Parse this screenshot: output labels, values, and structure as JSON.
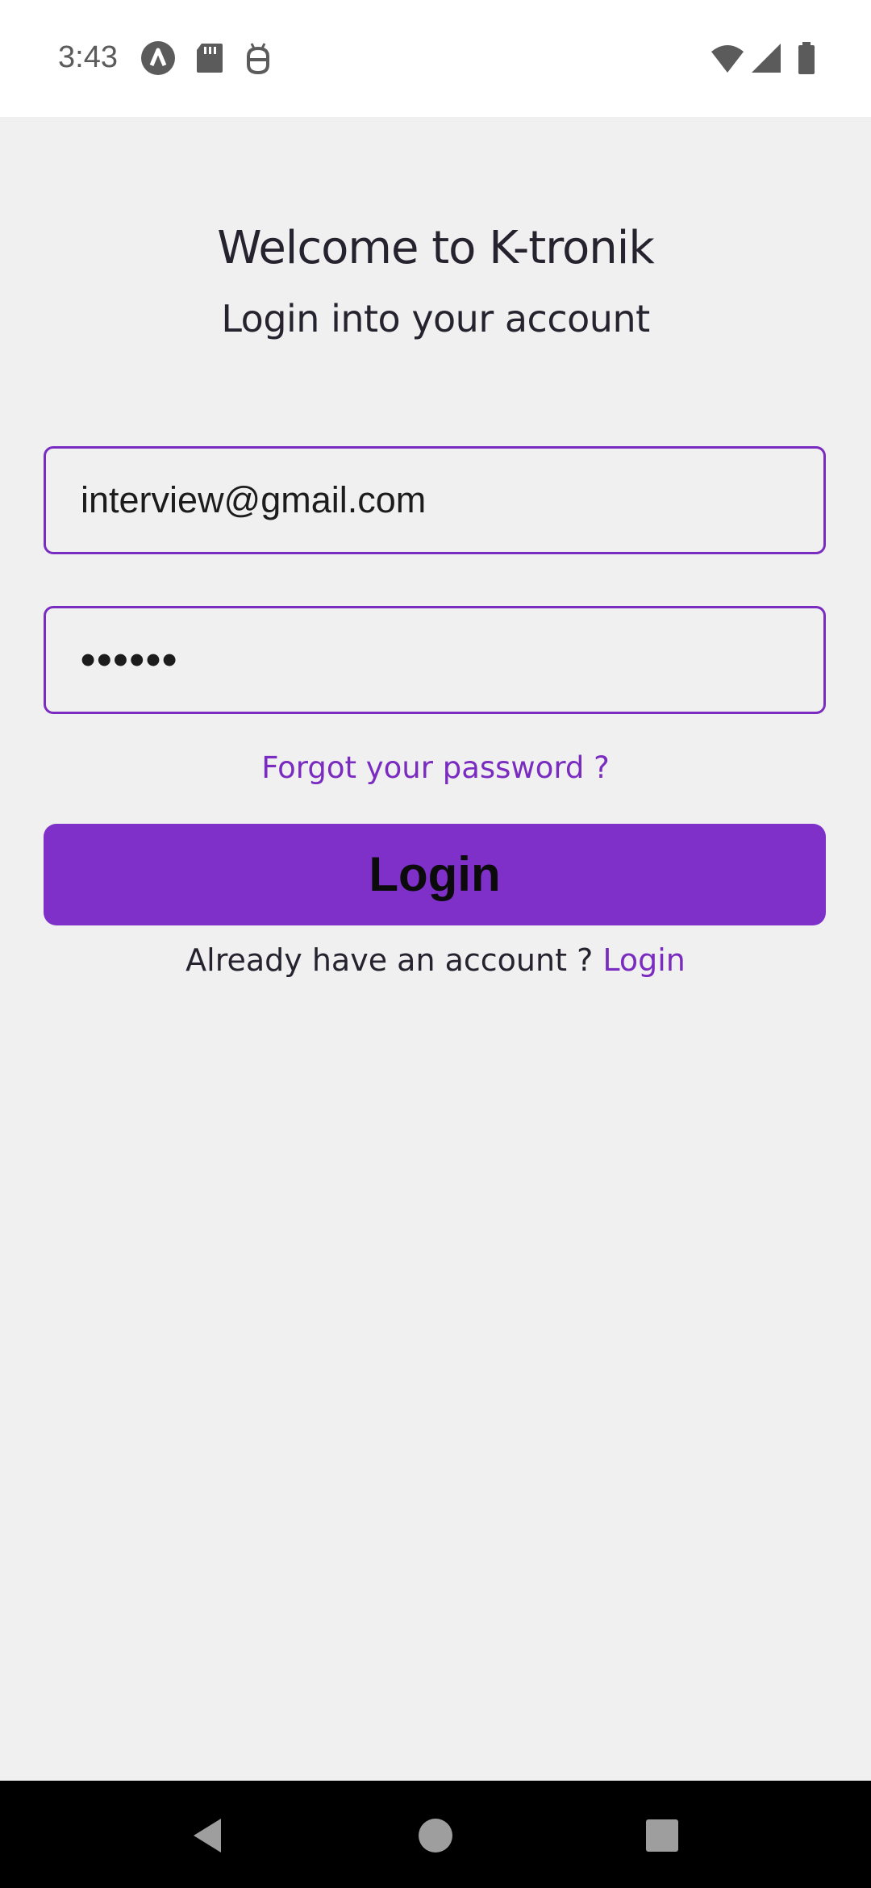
{
  "status_bar": {
    "time": "3:43",
    "icons": [
      "app-a-icon",
      "sd-card-icon",
      "android-debug-icon",
      "wifi-icon",
      "signal-icon",
      "battery-icon"
    ]
  },
  "header": {
    "title": "Welcome to K-tronik",
    "subtitle": "Login into your account"
  },
  "form": {
    "email_value": "interview@gmail.com",
    "password_value": "••••••",
    "forgot_label": "Forgot your password ?",
    "login_label": "Login"
  },
  "footer": {
    "prompt": "Already have an account ?",
    "link": "Login"
  },
  "nav_bar": {
    "icons": [
      "back-icon",
      "home-icon",
      "recents-icon"
    ]
  },
  "colors": {
    "accent": "#7b2cc0",
    "button": "#7e30c9",
    "background": "#f0f0f1"
  }
}
